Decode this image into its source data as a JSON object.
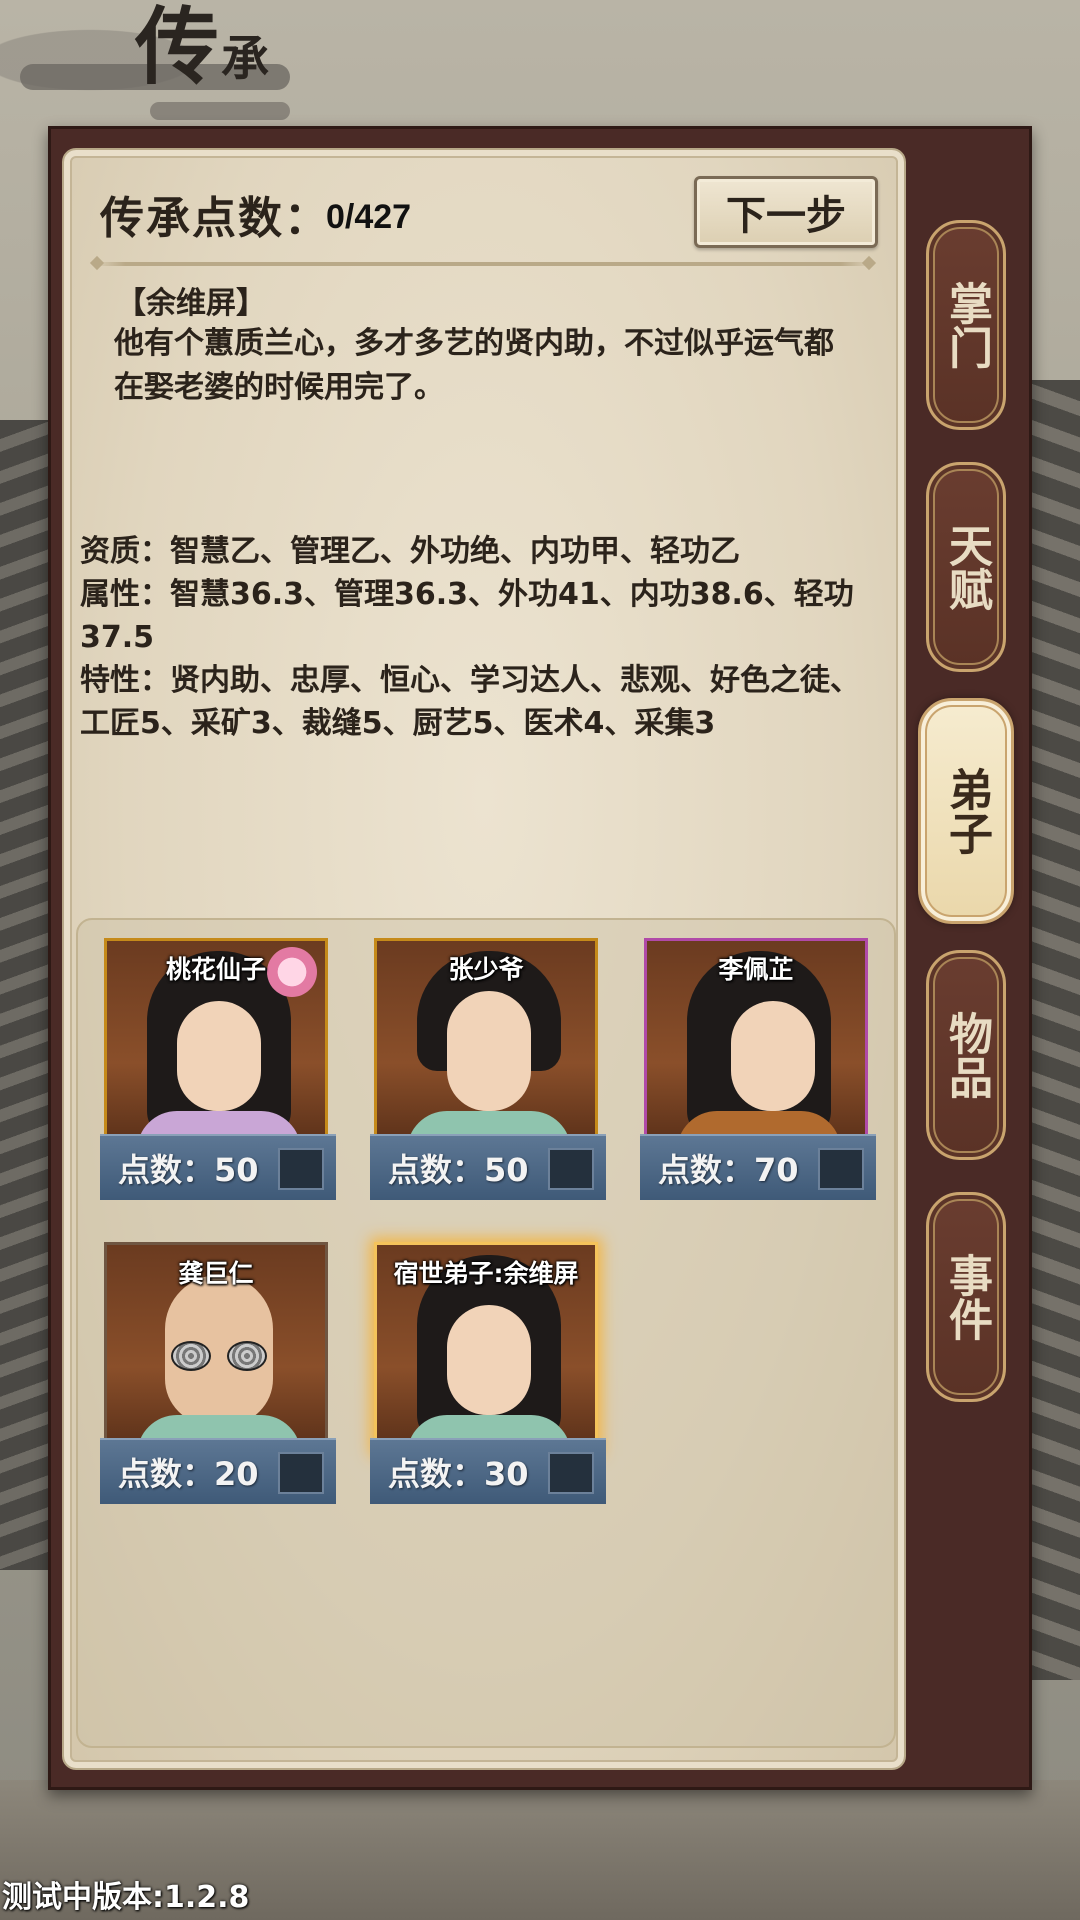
{
  "top_title": {
    "main": "传",
    "sub": "承"
  },
  "header": {
    "points_label": "传承点数：",
    "points_value": "0/427",
    "next_button": "下一步"
  },
  "description": {
    "name": "【余维屏】",
    "text": "他有个蕙质兰心，多才多艺的贤内助，不过似乎运气都在娶老婆的时候用完了。"
  },
  "stats": {
    "aptitude": "资质：智慧乙、管理乙、外功绝、内功甲、轻功乙",
    "attributes": "属性：智慧36.3、管理36.3、外功41、内功38.6、轻功37.5",
    "traits": "特性：贤内助、忠厚、恒心、学习达人、悲观、好色之徒、工匠5、采矿3、裁缝5、厨艺5、医术4、采集3"
  },
  "cards": [
    {
      "name": "桃花仙子",
      "points": "点数：50",
      "border": "gold"
    },
    {
      "name": "张少爷",
      "points": "点数：50",
      "border": "gold"
    },
    {
      "name": "李佩芷",
      "points": "点数：70",
      "border": "purple"
    },
    {
      "name": "龚巨仁",
      "points": "点数：20",
      "border": "brown"
    },
    {
      "name": "宿世弟子:余维屏",
      "points": "点数：30",
      "border": "gold-glow"
    }
  ],
  "tabs": [
    {
      "label": "掌门",
      "active": false
    },
    {
      "label": "天赋",
      "active": false
    },
    {
      "label": "弟子",
      "active": true
    },
    {
      "label": "物品",
      "active": false
    },
    {
      "label": "事件",
      "active": false
    }
  ],
  "version": "测试中版本:1.2.8",
  "colors": {
    "frame": "#4a2a26",
    "panel": "#e6dcc6",
    "points_bar": "#4d6886",
    "card_gold_border": "#c58a1a",
    "card_purple_border": "#b04aa8",
    "tab_active": "#f2e5c4",
    "tab_inactive": "#62382b"
  }
}
